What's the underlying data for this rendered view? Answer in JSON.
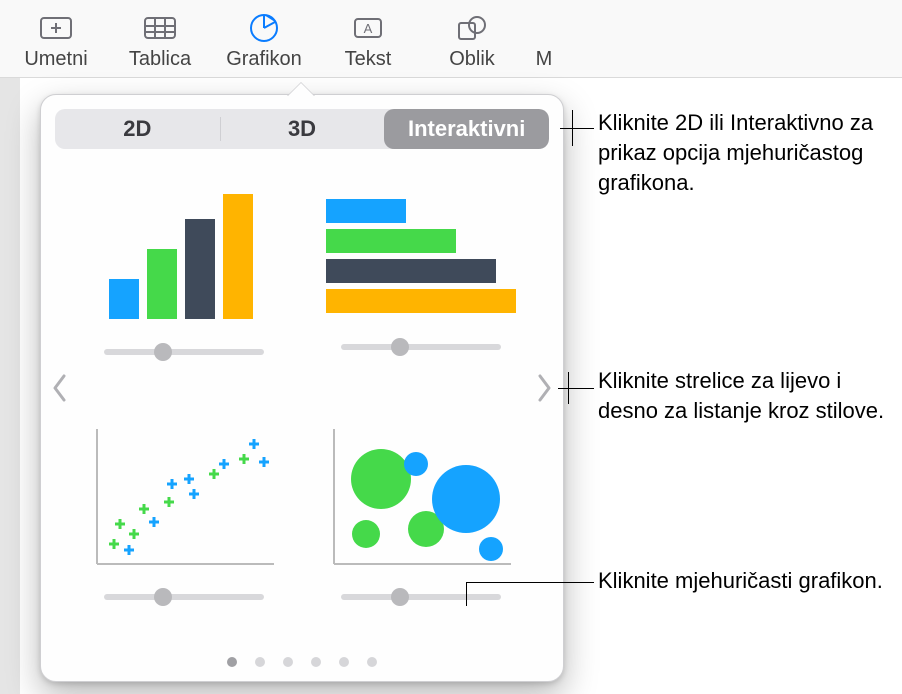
{
  "toolbar": {
    "insert": "Umetni",
    "table": "Tablica",
    "chart": "Grafikon",
    "text": "Tekst",
    "shape": "Oblik",
    "more": "M"
  },
  "popover": {
    "tabs": {
      "twod": "2D",
      "threed": "3D",
      "interactive": "Interaktivni"
    },
    "charts": {
      "vbar": "interactive-column-chart",
      "hbar": "interactive-bar-chart",
      "scatter": "interactive-scatter-chart",
      "bubble": "interactive-bubble-chart"
    }
  },
  "callouts": {
    "segmented": "Kliknite 2D ili Interaktivno za prikaz opcija mjehuričastog grafikona.",
    "arrows": "Kliknite strelice za lijevo i desno za listanje kroz stilove.",
    "bubble": "Kliknite mjehuričasti grafikon."
  }
}
